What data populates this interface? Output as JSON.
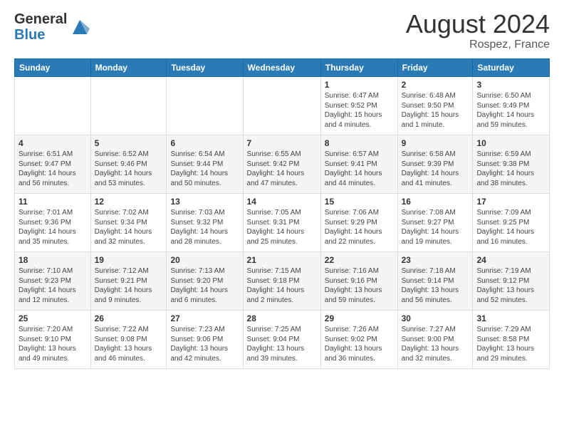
{
  "logo": {
    "general": "General",
    "blue": "Blue"
  },
  "header": {
    "month": "August 2024",
    "location": "Rospez, France"
  },
  "days_of_week": [
    "Sunday",
    "Monday",
    "Tuesday",
    "Wednesday",
    "Thursday",
    "Friday",
    "Saturday"
  ],
  "weeks": [
    [
      {
        "day": "",
        "info": ""
      },
      {
        "day": "",
        "info": ""
      },
      {
        "day": "",
        "info": ""
      },
      {
        "day": "",
        "info": ""
      },
      {
        "day": "1",
        "info": "Sunrise: 6:47 AM\nSunset: 9:52 PM\nDaylight: 15 hours\nand 4 minutes."
      },
      {
        "day": "2",
        "info": "Sunrise: 6:48 AM\nSunset: 9:50 PM\nDaylight: 15 hours\nand 1 minute."
      },
      {
        "day": "3",
        "info": "Sunrise: 6:50 AM\nSunset: 9:49 PM\nDaylight: 14 hours\nand 59 minutes."
      }
    ],
    [
      {
        "day": "4",
        "info": "Sunrise: 6:51 AM\nSunset: 9:47 PM\nDaylight: 14 hours\nand 56 minutes."
      },
      {
        "day": "5",
        "info": "Sunrise: 6:52 AM\nSunset: 9:46 PM\nDaylight: 14 hours\nand 53 minutes."
      },
      {
        "day": "6",
        "info": "Sunrise: 6:54 AM\nSunset: 9:44 PM\nDaylight: 14 hours\nand 50 minutes."
      },
      {
        "day": "7",
        "info": "Sunrise: 6:55 AM\nSunset: 9:42 PM\nDaylight: 14 hours\nand 47 minutes."
      },
      {
        "day": "8",
        "info": "Sunrise: 6:57 AM\nSunset: 9:41 PM\nDaylight: 14 hours\nand 44 minutes."
      },
      {
        "day": "9",
        "info": "Sunrise: 6:58 AM\nSunset: 9:39 PM\nDaylight: 14 hours\nand 41 minutes."
      },
      {
        "day": "10",
        "info": "Sunrise: 6:59 AM\nSunset: 9:38 PM\nDaylight: 14 hours\nand 38 minutes."
      }
    ],
    [
      {
        "day": "11",
        "info": "Sunrise: 7:01 AM\nSunset: 9:36 PM\nDaylight: 14 hours\nand 35 minutes."
      },
      {
        "day": "12",
        "info": "Sunrise: 7:02 AM\nSunset: 9:34 PM\nDaylight: 14 hours\nand 32 minutes."
      },
      {
        "day": "13",
        "info": "Sunrise: 7:03 AM\nSunset: 9:32 PM\nDaylight: 14 hours\nand 28 minutes."
      },
      {
        "day": "14",
        "info": "Sunrise: 7:05 AM\nSunset: 9:31 PM\nDaylight: 14 hours\nand 25 minutes."
      },
      {
        "day": "15",
        "info": "Sunrise: 7:06 AM\nSunset: 9:29 PM\nDaylight: 14 hours\nand 22 minutes."
      },
      {
        "day": "16",
        "info": "Sunrise: 7:08 AM\nSunset: 9:27 PM\nDaylight: 14 hours\nand 19 minutes."
      },
      {
        "day": "17",
        "info": "Sunrise: 7:09 AM\nSunset: 9:25 PM\nDaylight: 14 hours\nand 16 minutes."
      }
    ],
    [
      {
        "day": "18",
        "info": "Sunrise: 7:10 AM\nSunset: 9:23 PM\nDaylight: 14 hours\nand 12 minutes."
      },
      {
        "day": "19",
        "info": "Sunrise: 7:12 AM\nSunset: 9:21 PM\nDaylight: 14 hours\nand 9 minutes."
      },
      {
        "day": "20",
        "info": "Sunrise: 7:13 AM\nSunset: 9:20 PM\nDaylight: 14 hours\nand 6 minutes."
      },
      {
        "day": "21",
        "info": "Sunrise: 7:15 AM\nSunset: 9:18 PM\nDaylight: 14 hours\nand 2 minutes."
      },
      {
        "day": "22",
        "info": "Sunrise: 7:16 AM\nSunset: 9:16 PM\nDaylight: 13 hours\nand 59 minutes."
      },
      {
        "day": "23",
        "info": "Sunrise: 7:18 AM\nSunset: 9:14 PM\nDaylight: 13 hours\nand 56 minutes."
      },
      {
        "day": "24",
        "info": "Sunrise: 7:19 AM\nSunset: 9:12 PM\nDaylight: 13 hours\nand 52 minutes."
      }
    ],
    [
      {
        "day": "25",
        "info": "Sunrise: 7:20 AM\nSunset: 9:10 PM\nDaylight: 13 hours\nand 49 minutes."
      },
      {
        "day": "26",
        "info": "Sunrise: 7:22 AM\nSunset: 9:08 PM\nDaylight: 13 hours\nand 46 minutes."
      },
      {
        "day": "27",
        "info": "Sunrise: 7:23 AM\nSunset: 9:06 PM\nDaylight: 13 hours\nand 42 minutes."
      },
      {
        "day": "28",
        "info": "Sunrise: 7:25 AM\nSunset: 9:04 PM\nDaylight: 13 hours\nand 39 minutes."
      },
      {
        "day": "29",
        "info": "Sunrise: 7:26 AM\nSunset: 9:02 PM\nDaylight: 13 hours\nand 36 minutes."
      },
      {
        "day": "30",
        "info": "Sunrise: 7:27 AM\nSunset: 9:00 PM\nDaylight: 13 hours\nand 32 minutes."
      },
      {
        "day": "31",
        "info": "Sunrise: 7:29 AM\nSunset: 8:58 PM\nDaylight: 13 hours\nand 29 minutes."
      }
    ]
  ]
}
